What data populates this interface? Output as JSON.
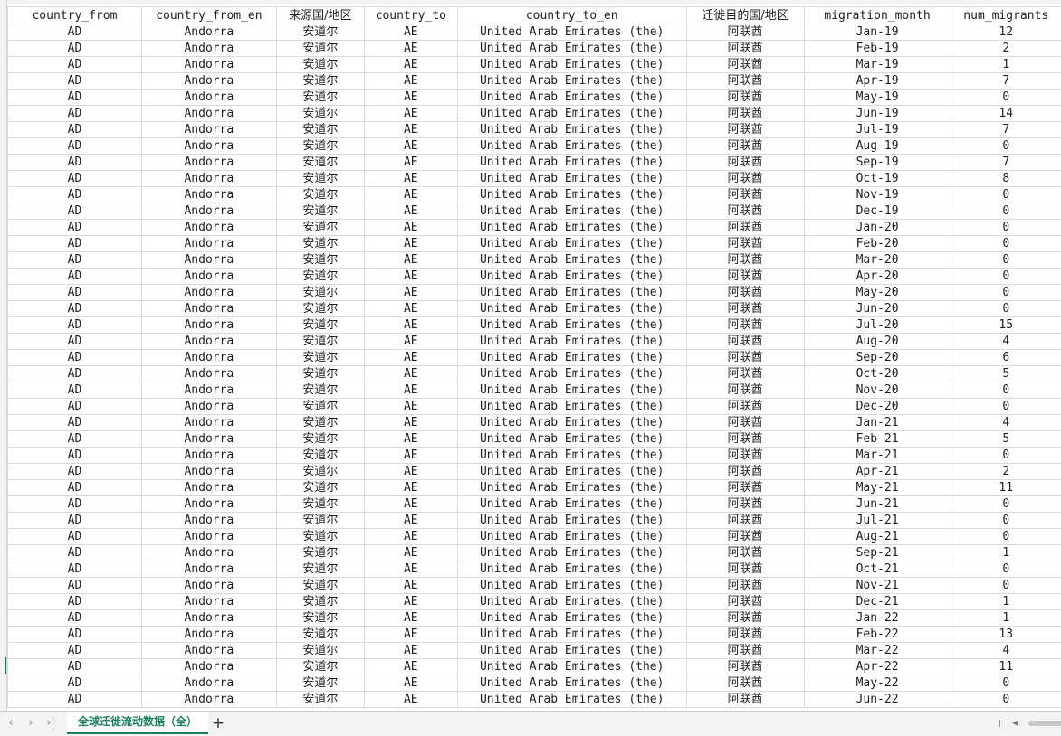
{
  "sheet": {
    "columns": [
      {
        "key": "country_from",
        "label": "country_from"
      },
      {
        "key": "country_from_en",
        "label": "country_from_en"
      },
      {
        "key": "from_zh",
        "label": "来源国/地区"
      },
      {
        "key": "country_to",
        "label": "country_to"
      },
      {
        "key": "country_to_en",
        "label": "country_to_en"
      },
      {
        "key": "to_zh",
        "label": "迁徙目的国/地区"
      },
      {
        "key": "migration_month",
        "label": "migration_month"
      },
      {
        "key": "num_migrants",
        "label": "num_migrants"
      }
    ],
    "row_template": {
      "country_from": "AD",
      "country_from_en": "Andorra",
      "from_zh": "安道尔",
      "country_to": "AE",
      "country_to_en": "United Arab Emirates (the)",
      "to_zh": "阿联酋"
    },
    "months": [
      "Jan-19",
      "Feb-19",
      "Mar-19",
      "Apr-19",
      "May-19",
      "Jun-19",
      "Jul-19",
      "Aug-19",
      "Sep-19",
      "Oct-19",
      "Nov-19",
      "Dec-19",
      "Jan-20",
      "Feb-20",
      "Mar-20",
      "Apr-20",
      "May-20",
      "Jun-20",
      "Jul-20",
      "Aug-20",
      "Sep-20",
      "Oct-20",
      "Nov-20",
      "Dec-20",
      "Jan-21",
      "Feb-21",
      "Mar-21",
      "Apr-21",
      "May-21",
      "Jun-21",
      "Jul-21",
      "Aug-21",
      "Sep-21",
      "Oct-21",
      "Nov-21",
      "Dec-21",
      "Jan-22",
      "Feb-22",
      "Mar-22",
      "Apr-22",
      "May-22",
      "Jun-22"
    ],
    "num_migrants": [
      12,
      2,
      1,
      7,
      0,
      14,
      7,
      0,
      7,
      8,
      0,
      0,
      0,
      0,
      0,
      0,
      0,
      0,
      15,
      4,
      6,
      5,
      0,
      0,
      4,
      5,
      0,
      2,
      11,
      0,
      0,
      0,
      1,
      0,
      0,
      1,
      1,
      13,
      4,
      11,
      0,
      0
    ]
  },
  "tabs": {
    "nav": {
      "first": "‹",
      "prev": "›",
      "last": "›|"
    },
    "active_sheet": "全球迁徙流动数据（全）",
    "add": "+"
  },
  "colors": {
    "accent": "#1b7f5f",
    "grid": "#dadada",
    "chrome": "#f3f3f3"
  }
}
